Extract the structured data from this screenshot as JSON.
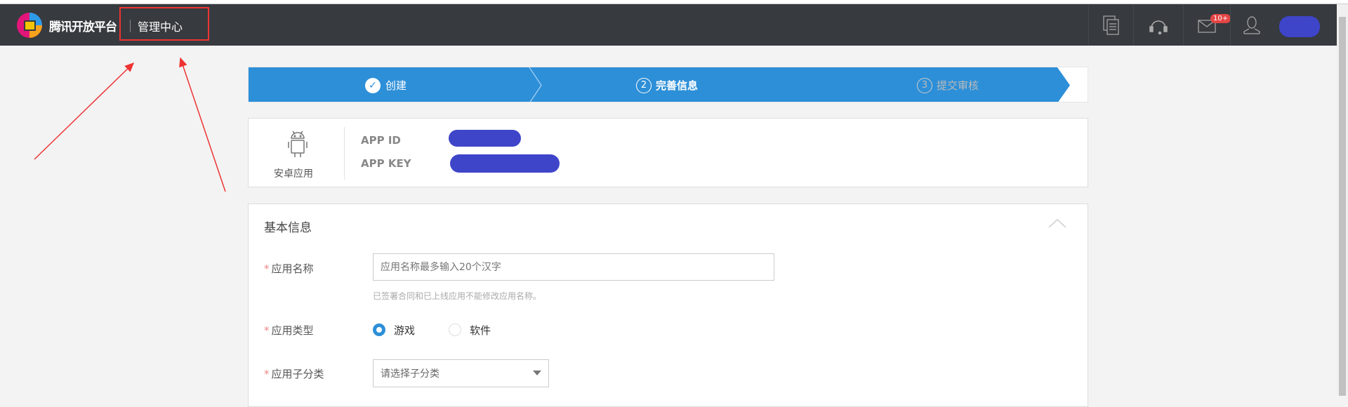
{
  "header": {
    "brand": "腾讯开放平台",
    "section": "管理中心",
    "mail_badge": "10+",
    "icons": [
      "documents-icon",
      "headset-icon",
      "mail-icon",
      "user-icon"
    ]
  },
  "steps": [
    {
      "num": "✓",
      "label": "创建",
      "state": "done"
    },
    {
      "num": "2",
      "label": "完善信息",
      "state": "active"
    },
    {
      "num": "3",
      "label": "提交审核",
      "state": "pending"
    }
  ],
  "app": {
    "platform_label": "安卓应用",
    "app_id_label": "APP ID",
    "app_key_label": "APP KEY"
  },
  "basic": {
    "title": "基本信息",
    "name_label": "应用名称",
    "name_placeholder": "应用名称最多输入20个汉字",
    "name_hint": "已签署合同和已上线应用不能修改应用名称。",
    "type_label": "应用类型",
    "type_options": [
      "游戏",
      "软件"
    ],
    "type_selected": "游戏",
    "subcat_label": "应用子分类",
    "subcat_value": "请选择子分类",
    "required_mark": "*"
  },
  "colors": {
    "header": "#373a3e",
    "accent": "#2d8fd8",
    "badge": "#e64545",
    "annotation": "#e33333"
  }
}
